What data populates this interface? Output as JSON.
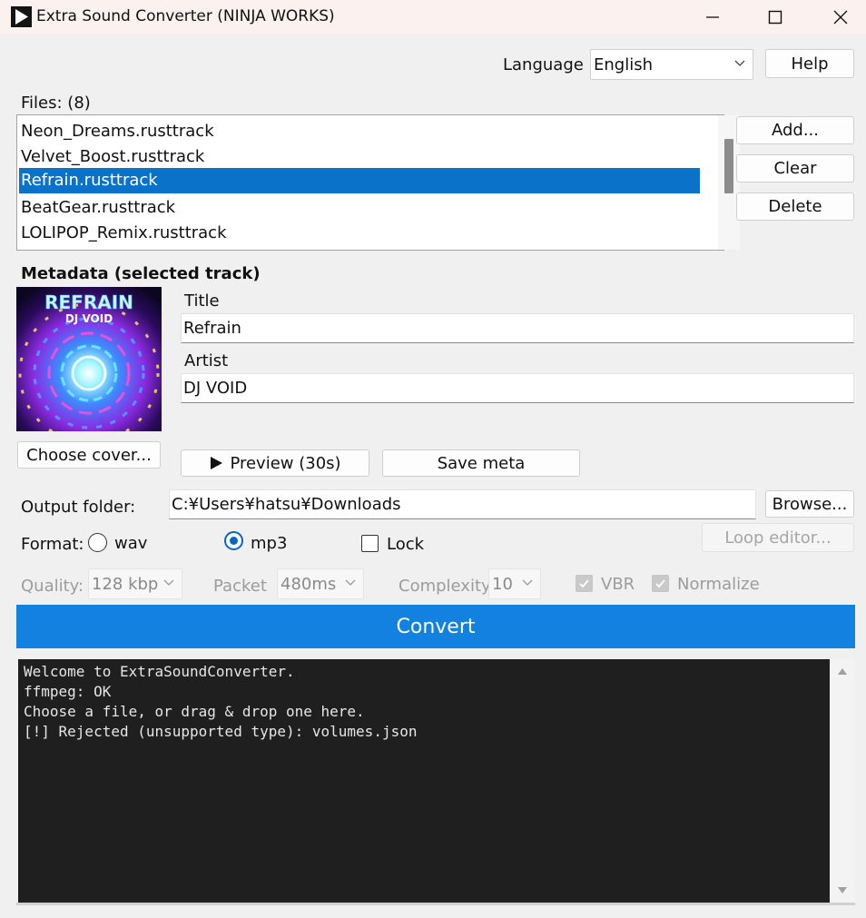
{
  "window": {
    "title": "Extra Sound Converter (NINJA WORKS)"
  },
  "header": {
    "language_label": "Language",
    "language_value": "English",
    "help_label": "Help"
  },
  "files": {
    "label": "Files:",
    "count": "(8)",
    "items": [
      "Neon_Dreams.rusttrack",
      "Velvet_Boost.rusttrack",
      "Refrain.rusttrack",
      "BeatGear.rusttrack",
      "LOLIPOP_Remix.rusttrack"
    ],
    "selected_index": 2,
    "add_label": "Add...",
    "clear_label": "Clear",
    "delete_label": "Delete"
  },
  "metadata": {
    "heading": "Metadata (selected track)",
    "cover_title_text": "REFRAIN",
    "cover_artist_text": "DJ VOID",
    "title_label": "Title",
    "title_value": "Refrain",
    "artist_label": "Artist",
    "artist_value": "DJ VOID",
    "choose_cover_label": "Choose cover...",
    "preview_label": "Preview (30s)",
    "save_meta_label": "Save meta"
  },
  "output": {
    "folder_label": "Output folder:",
    "folder_value": "C:¥Users¥hatsu¥Downloads",
    "browse_label": "Browse..."
  },
  "format": {
    "label": "Format:",
    "options": [
      "wav",
      "mp3"
    ],
    "selected": "mp3",
    "lock_label": "Lock",
    "lock_checked": false,
    "loop_editor_label": "Loop editor..."
  },
  "encoding": {
    "quality_label": "Quality:",
    "quality_value": "128 kbp",
    "packet_label": "Packet",
    "packet_value": "480ms",
    "complexity_label": "Complexity",
    "complexity_value": "10",
    "vbr_label": "VBR",
    "vbr_checked": true,
    "normalize_label": "Normalize",
    "normalize_checked": true
  },
  "convert_label": "Convert",
  "log": {
    "lines": [
      "Welcome to ExtraSoundConverter.",
      "ffmpeg: OK",
      "Choose a file, or drag & drop one here.",
      "[!] Rejected (unsupported type): volumes.json"
    ]
  },
  "colors": {
    "accent": "#1281e0",
    "selection": "#0a72c8",
    "log_bg": "#1f1f1f"
  }
}
